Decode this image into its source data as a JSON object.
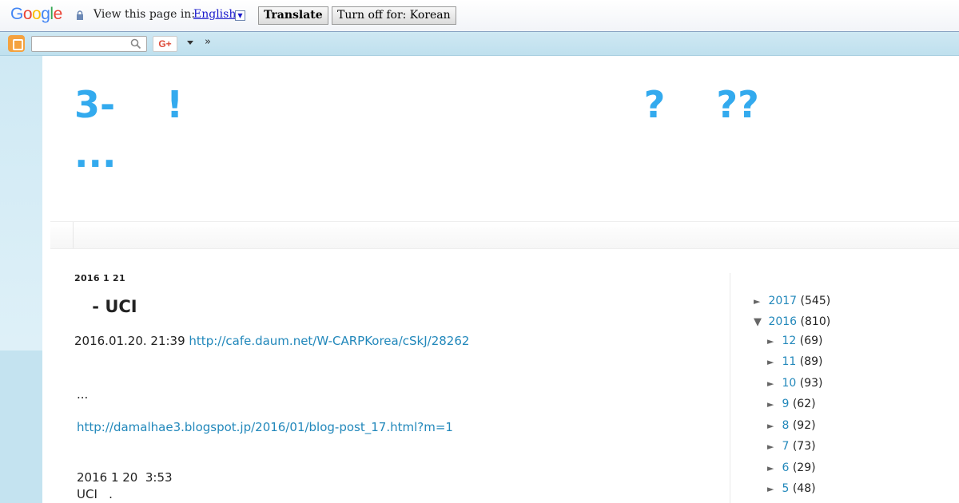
{
  "translate_bar": {
    "logo": [
      {
        "ch": "G",
        "color": "#4285f4"
      },
      {
        "ch": "o",
        "color": "#ea4335"
      },
      {
        "ch": "o",
        "color": "#fbbc05"
      },
      {
        "ch": "g",
        "color": "#4285f4"
      },
      {
        "ch": "l",
        "color": "#34a853"
      },
      {
        "ch": "e",
        "color": "#ea4335"
      }
    ],
    "view_label": "View this page in:",
    "language": "English",
    "translate_button": "Translate",
    "turn_off_button": "Turn off for: Korean"
  },
  "navbar": {
    "gplus_label": "G+",
    "more_label": "»"
  },
  "blog": {
    "title_line1": "3-    !                                    ?    ??",
    "title_line2": "...",
    "title_color": "#33aaee"
  },
  "post": {
    "date": "2016 1 21",
    "title": " - UCI",
    "meta_text": "2016.01.20. 21:39 ",
    "meta_link": "http://cafe.daum.net/W-CARPKorea/cSkJ/28262",
    "ellipsis": "...",
    "link_2": "http://damalhae3.blogspot.jp/2016/01/blog-post_17.html?m=1",
    "line_3": "2016 1 20  3:53",
    "line_4": "UCI   ."
  },
  "archive": {
    "years": [
      {
        "toggle": "►",
        "label": "2017",
        "count": "(545)"
      },
      {
        "toggle": "▼",
        "label": "2016",
        "count": "(810)"
      }
    ],
    "months": [
      {
        "toggle": "►",
        "label": "12",
        "count": "(69)"
      },
      {
        "toggle": "►",
        "label": "11",
        "count": "(89)"
      },
      {
        "toggle": "►",
        "label": "10",
        "count": "(93)"
      },
      {
        "toggle": "►",
        "label": "9",
        "count": "(62)"
      },
      {
        "toggle": "►",
        "label": "8",
        "count": "(92)"
      },
      {
        "toggle": "►",
        "label": "7",
        "count": "(73)"
      },
      {
        "toggle": "►",
        "label": "6",
        "count": "(29)"
      },
      {
        "toggle": "►",
        "label": "5",
        "count": "(48)"
      }
    ]
  }
}
